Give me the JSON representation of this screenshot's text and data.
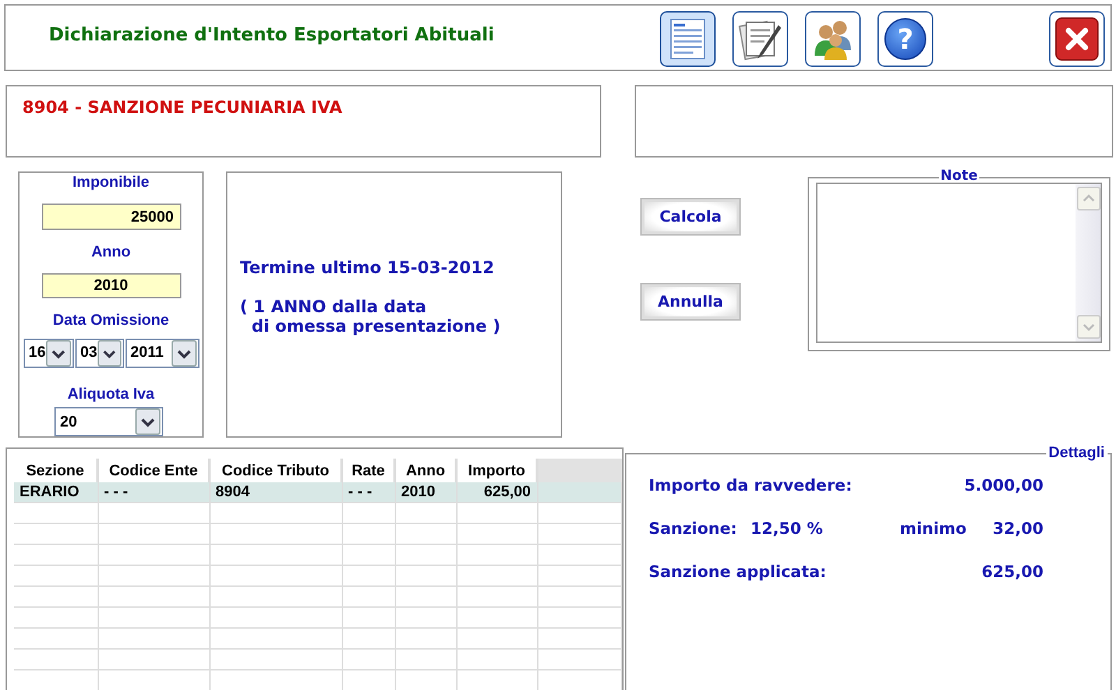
{
  "header": {
    "title": "Dichiarazione d'Intento Esportatori Abituali"
  },
  "toolbar": [
    {
      "kind": "form",
      "selected": true
    },
    {
      "kind": "document",
      "selected": false
    },
    {
      "kind": "users",
      "selected": false
    },
    {
      "kind": "help",
      "glyph": "?",
      "selected": false
    }
  ],
  "close_button": {
    "kind": "close"
  },
  "code_box": {
    "text": "8904 - SANZIONE PECUNIARIA IVA"
  },
  "form": {
    "imponibile": {
      "label": "Imponibile",
      "value": "25000"
    },
    "anno": {
      "label": "Anno",
      "value": "2010"
    },
    "data_omissione": {
      "label": "Data Omissione",
      "day": "16",
      "month": "03",
      "year": "2011"
    },
    "aliquota": {
      "label": "Aliquota Iva",
      "value": "20"
    }
  },
  "deadline": {
    "title": "Termine ultimo 15-03-2012",
    "note": "( 1 ANNO dalla data\n  di omessa presentazione )"
  },
  "buttons": [
    {
      "label": "Calcola"
    },
    {
      "label": "Annulla"
    }
  ],
  "note": {
    "legend": "Note"
  },
  "table": {
    "columns": [
      "Sezione",
      "Codice Ente",
      "Codice Tributo",
      "Rate",
      "Anno",
      "Importo"
    ],
    "rows": [
      {
        "cells": [
          "ERARIO",
          "- - -",
          "8904",
          "- - -",
          "2010",
          "625,00"
        ],
        "selected": true
      }
    ]
  },
  "details": {
    "legend": "Dettagli",
    "rows": [
      {
        "label": "Importo da ravvedere:",
        "value": "5.000,00"
      },
      {
        "label": "Sanzione:",
        "rate": "12,50 %",
        "min_label": "minimo",
        "value": "32,00"
      },
      {
        "label": "Sanzione applicata:",
        "value": "625,00"
      }
    ]
  }
}
